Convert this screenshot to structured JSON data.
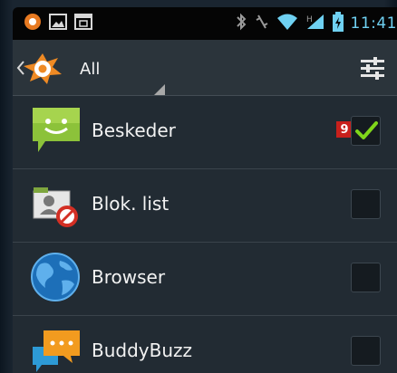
{
  "status_bar": {
    "time": "11:41",
    "icons": [
      "avast-notification-icon",
      "image-icon",
      "calendar-icon",
      "bluetooth-icon",
      "vibrate-icon",
      "wifi-icon",
      "signal-icon",
      "battery-icon"
    ]
  },
  "action_bar": {
    "title": "All",
    "icons": [
      "avast-logo-icon",
      "settings-sliders-icon"
    ]
  },
  "apps": [
    {
      "name": "Beskeder",
      "checked": true,
      "badge": "9",
      "icon": "messaging-icon"
    },
    {
      "name": "Blok. list",
      "checked": false,
      "icon": "block-list-icon"
    },
    {
      "name": "Browser",
      "checked": false,
      "icon": "browser-globe-icon"
    },
    {
      "name": "BuddyBuzz",
      "checked": false,
      "icon": "buddybuzz-icon"
    }
  ],
  "colors": {
    "accent": "#6fd1f2",
    "check": "#7fd61a",
    "badge": "#c8201c",
    "list_bg": "#222b33"
  }
}
